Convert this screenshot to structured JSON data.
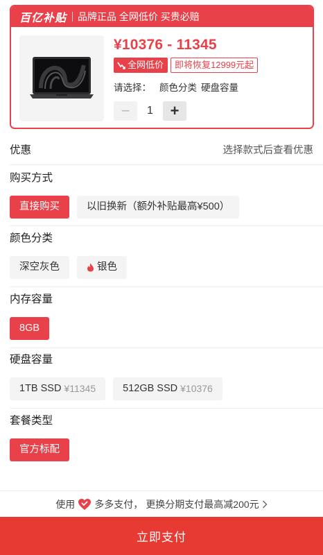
{
  "card": {
    "brand": "百亿补贴",
    "slogan": "品牌正品 全网低价 买贵必赔",
    "price": "¥10376 - 11345",
    "tag_lowest": "全网低价",
    "tag_restore": "即将恢复12999元起",
    "select_prompt": "请选择：",
    "select_color": "颜色分类",
    "select_storage": "硬盘容量",
    "qty_minus": "−",
    "qty_value": "1",
    "qty_plus": "+"
  },
  "discount": {
    "title": "优惠",
    "hint": "选择款式后查看优惠"
  },
  "purchase": {
    "title": "购买方式",
    "options": [
      {
        "label": "直接购买",
        "selected": true
      },
      {
        "label": "以旧换新（额外补贴最高¥500）",
        "selected": false
      }
    ]
  },
  "color": {
    "title": "颜色分类",
    "options": [
      {
        "label": "深空灰色",
        "selected": false
      },
      {
        "label": "银色",
        "icon": "flame-icon",
        "selected": false
      }
    ]
  },
  "memory": {
    "title": "内存容量",
    "options": [
      {
        "label": "8GB",
        "selected": true
      }
    ]
  },
  "storage": {
    "title": "硬盘容量",
    "options": [
      {
        "label": "1TB SSD",
        "sub": "¥11345",
        "selected": false
      },
      {
        "label": "512GB SSD",
        "sub": "¥10376",
        "selected": false
      }
    ]
  },
  "bundle": {
    "title": "套餐类型",
    "options": [
      {
        "label": "官方标配",
        "selected": true
      }
    ]
  },
  "pay_note": {
    "prefix": "使用",
    "method": "多多支付，",
    "suffix": "更换分期支付最高减200元",
    "icon": "heart-pay-icon",
    "arrow": "chevron-right-icon"
  },
  "pay_button": "立即支付",
  "colors": {
    "accent": "#e8414a",
    "button": "#e63a32",
    "chip_bg": "#f4f4f4"
  }
}
